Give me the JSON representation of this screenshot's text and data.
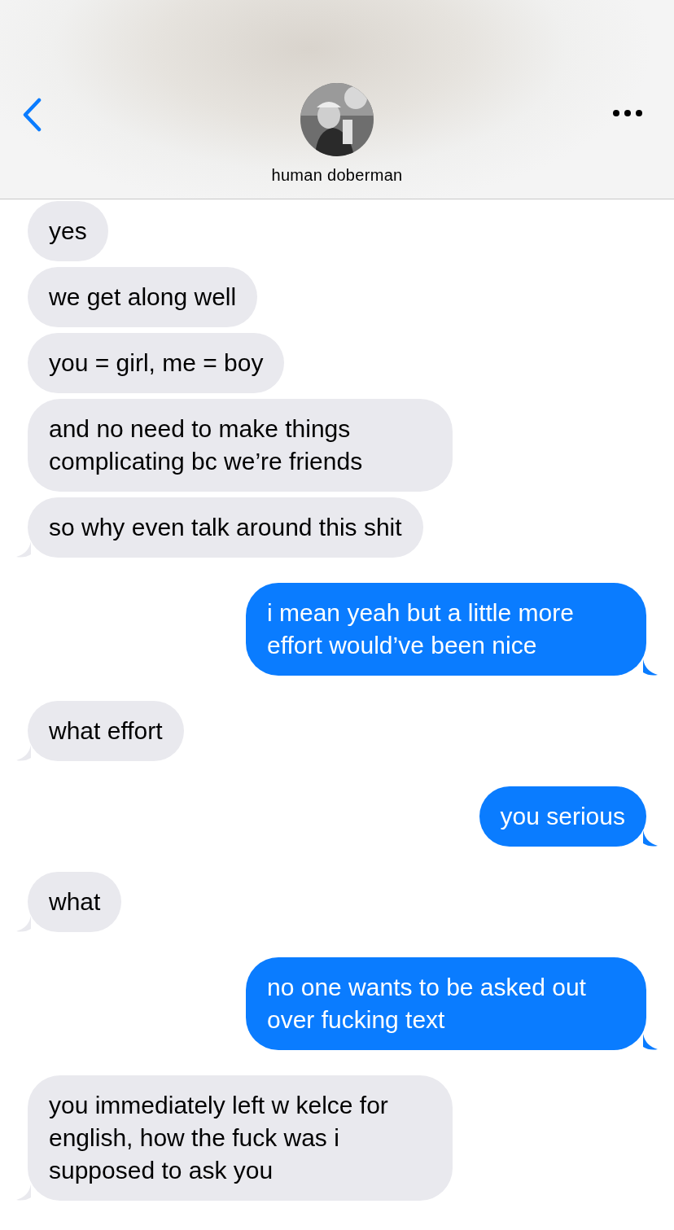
{
  "header": {
    "contact_name": "human doberman"
  },
  "messages": [
    {
      "kind": "received",
      "text": "yes",
      "tail": false
    },
    {
      "kind": "received",
      "text": "we get along well",
      "tail": false
    },
    {
      "kind": "received",
      "text": "you = girl, me = boy",
      "tail": false
    },
    {
      "kind": "received",
      "text": "and no need to make things complicating bc we’re friends",
      "tail": false
    },
    {
      "kind": "received",
      "text": "so why even talk around this shit",
      "tail": true
    },
    {
      "kind": "sent",
      "text": "i mean yeah but a little more effort would’ve been nice",
      "tail": true
    },
    {
      "kind": "received",
      "text": "what effort",
      "tail": true
    },
    {
      "kind": "sent",
      "text": "you serious",
      "tail": true
    },
    {
      "kind": "received",
      "text": "what",
      "tail": true
    },
    {
      "kind": "sent",
      "text": "no one wants to be asked out over fucking text",
      "tail": true
    },
    {
      "kind": "received",
      "text": "you immediately left w kelce for english, how the fuck was i supposed to ask you",
      "tail": true
    }
  ]
}
